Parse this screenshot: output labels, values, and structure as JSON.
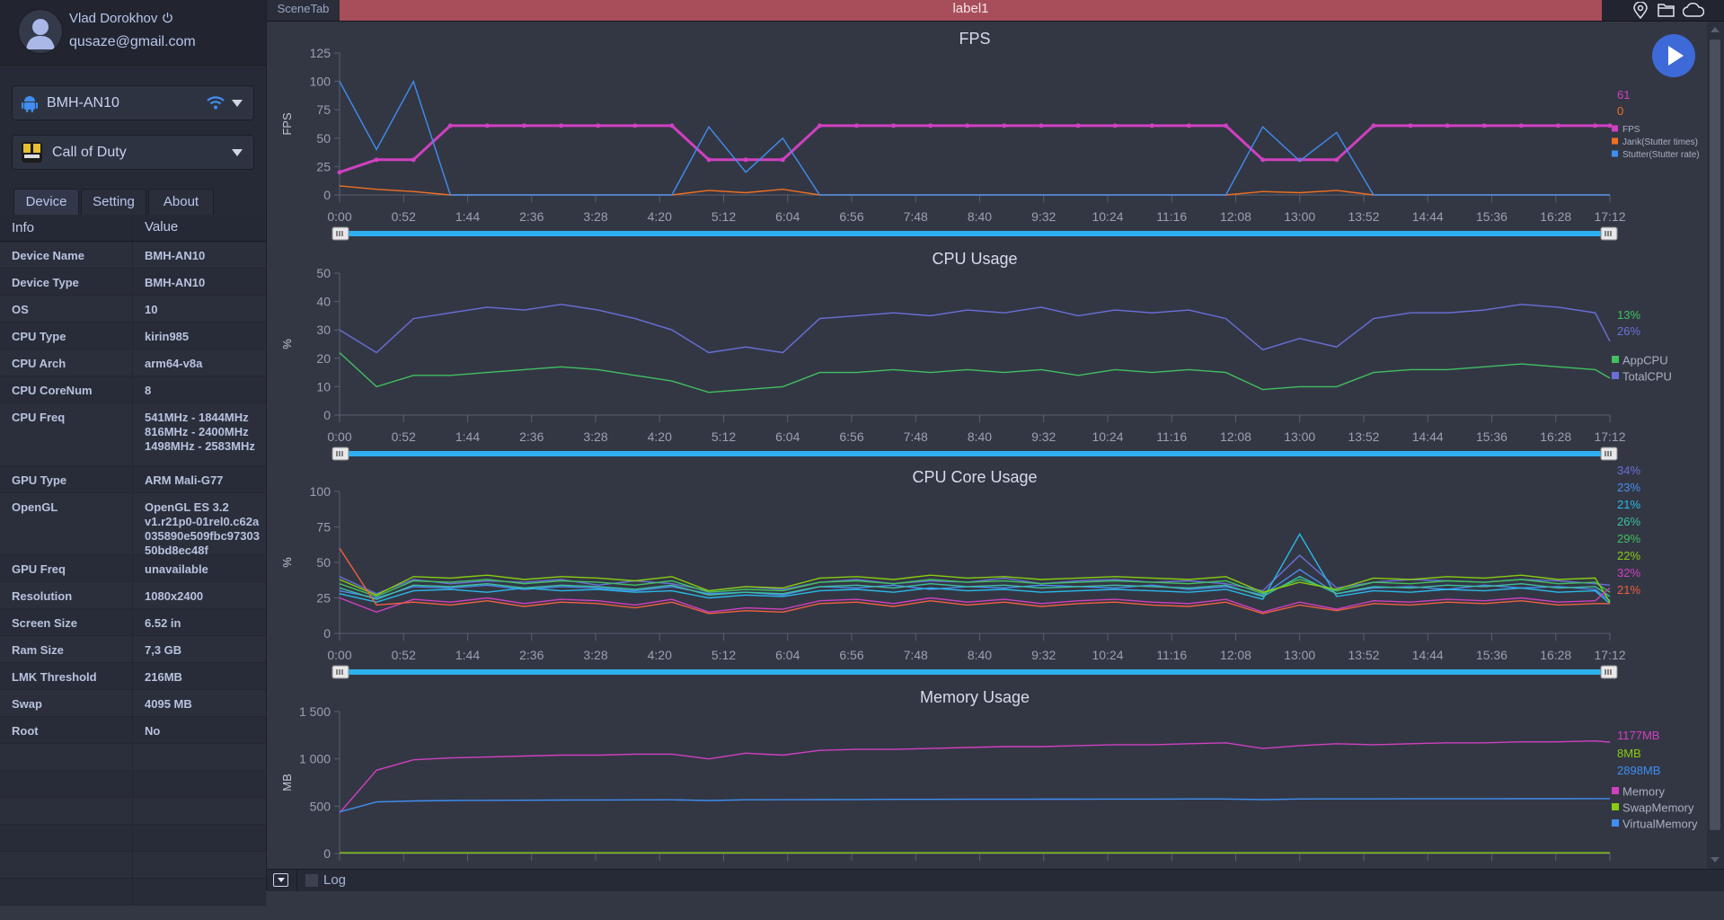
{
  "user": {
    "name": "Vlad Dorokhov",
    "email": "qusaze@gmail.com"
  },
  "device_select": {
    "value": "BMH-AN10"
  },
  "app_select": {
    "value": "Call of Duty"
  },
  "tabs": [
    "Device",
    "Setting",
    "About"
  ],
  "info_table": {
    "headers": [
      "Info",
      "Value"
    ],
    "rows": [
      [
        "Device Name",
        "BMH-AN10"
      ],
      [
        "Device Type",
        "BMH-AN10"
      ],
      [
        "OS",
        "10"
      ],
      [
        "CPU Type",
        "kirin985"
      ],
      [
        "CPU Arch",
        "arm64-v8a"
      ],
      [
        "CPU CoreNum",
        "8"
      ],
      [
        "CPU Freq",
        "541MHz - 1844MHz\n816MHz - 2400MHz\n1498MHz - 2583MHz"
      ],
      [
        "GPU Type",
        "ARM Mali-G77"
      ],
      [
        "OpenGL",
        "OpenGL ES 3.2\nv1.r21p0-01rel0.c62a035890e509fbc9730350bd8ec48f"
      ],
      [
        "GPU Freq",
        "unavailable"
      ],
      [
        "Resolution",
        "1080x2400"
      ],
      [
        "Screen Size",
        "6.52 in"
      ],
      [
        "Ram Size",
        "7,3 GB"
      ],
      [
        "LMK Threshold",
        "216MB"
      ],
      [
        "Swap",
        "4095 MB"
      ],
      [
        "Root",
        "No"
      ]
    ]
  },
  "topbar": {
    "scene_tab": "SceneTab",
    "label": "label1",
    "icons": [
      "location-pin-icon",
      "folder-icon",
      "cloud-icon"
    ]
  },
  "play_button": {
    "icon": "play-icon",
    "color": "#3d6ad8"
  },
  "bottombar": {
    "log_label": "Log",
    "log_checked": false
  },
  "colors": {
    "slider": "#2eb0f0",
    "label_bar": "#a84e5a"
  },
  "chart_data": [
    {
      "type": "line",
      "title": "FPS",
      "ylabel": "FPS",
      "ylim": [
        0,
        125
      ],
      "yticks": [
        "0",
        "25",
        "50",
        "75",
        "100",
        "125"
      ],
      "ytick_values": [
        0,
        25,
        50,
        75,
        100,
        125
      ],
      "xticks": [
        "0:00",
        "0:52",
        "1:44",
        "2:36",
        "3:28",
        "4:20",
        "5:12",
        "6:04",
        "6:56",
        "7:48",
        "8:40",
        "9:32",
        "10:24",
        "11:16",
        "12:08",
        "13:00",
        "13:52",
        "14:44",
        "15:36",
        "16:28",
        "17:12"
      ],
      "x": [
        "0:00",
        "0:30",
        "1:00",
        "1:30",
        "2:00",
        "2:30",
        "3:00",
        "3:30",
        "4:00",
        "4:30",
        "5:00",
        "5:30",
        "6:00",
        "6:30",
        "7:00",
        "7:30",
        "8:00",
        "8:30",
        "9:00",
        "9:30",
        "10:00",
        "10:30",
        "11:00",
        "11:30",
        "12:00",
        "12:30",
        "13:00",
        "13:30",
        "14:00",
        "14:30",
        "15:00",
        "15:30",
        "16:00",
        "16:30",
        "17:00",
        "17:12"
      ],
      "legend": "right",
      "current_values": [
        {
          "text": "61",
          "color": "#d040c0"
        },
        {
          "text": "0",
          "color": "#f07020"
        }
      ],
      "series": [
        {
          "name": "FPS",
          "color": "#d040c0",
          "markers": true,
          "values": [
            20,
            31,
            31,
            61,
            61,
            61,
            61,
            61,
            61,
            61,
            31,
            31,
            31,
            61,
            61,
            61,
            61,
            61,
            61,
            61,
            61,
            61,
            61,
            61,
            61,
            31,
            31,
            31,
            61,
            61,
            61,
            61,
            61,
            61,
            61,
            61
          ]
        },
        {
          "name": "Jank(Stutter times)",
          "color": "#f07020",
          "values": [
            8,
            5,
            3,
            0,
            0,
            0,
            0,
            0,
            0,
            0,
            4,
            2,
            5,
            0,
            0,
            0,
            0,
            0,
            0,
            0,
            0,
            0,
            0,
            0,
            0,
            3,
            2,
            4,
            0,
            0,
            0,
            0,
            0,
            0,
            0,
            0
          ]
        },
        {
          "name": "Stutter(Stutter rate)",
          "color": "#3f8ef0",
          "values": [
            100,
            40,
            100,
            0,
            0,
            0,
            0,
            0,
            0,
            0,
            60,
            20,
            50,
            0,
            0,
            0,
            0,
            0,
            0,
            0,
            0,
            0,
            0,
            0,
            0,
            60,
            30,
            55,
            0,
            0,
            0,
            0,
            0,
            0,
            0,
            0
          ]
        }
      ]
    },
    {
      "type": "line",
      "title": "CPU Usage",
      "ylabel": "%",
      "ylim": [
        0,
        50
      ],
      "yticks": [
        "0",
        "10",
        "20",
        "30",
        "40",
        "50"
      ],
      "ytick_values": [
        0,
        10,
        20,
        30,
        40,
        50
      ],
      "xticks": [
        "0:00",
        "0:52",
        "1:44",
        "2:36",
        "3:28",
        "4:20",
        "5:12",
        "6:04",
        "6:56",
        "7:48",
        "8:40",
        "9:32",
        "10:24",
        "11:16",
        "12:08",
        "13:00",
        "13:52",
        "14:44",
        "15:36",
        "16:28",
        "17:12"
      ],
      "x": [
        "0:00",
        "0:30",
        "1:00",
        "1:30",
        "2:00",
        "2:30",
        "3:00",
        "3:30",
        "4:00",
        "4:30",
        "5:00",
        "5:30",
        "6:00",
        "6:30",
        "7:00",
        "7:30",
        "8:00",
        "8:30",
        "9:00",
        "9:30",
        "10:00",
        "10:30",
        "11:00",
        "11:30",
        "12:00",
        "12:30",
        "13:00",
        "13:30",
        "14:00",
        "14:30",
        "15:00",
        "15:30",
        "16:00",
        "16:30",
        "17:00",
        "17:12"
      ],
      "legend": "right",
      "current_values": [
        {
          "text": "13%",
          "color": "#40c060"
        },
        {
          "text": "26%",
          "color": "#6a6fd8"
        }
      ],
      "series": [
        {
          "name": "AppCPU",
          "color": "#40c060",
          "values": [
            22,
            10,
            14,
            14,
            15,
            16,
            17,
            16,
            14,
            12,
            8,
            9,
            10,
            15,
            15,
            16,
            15,
            16,
            15,
            16,
            14,
            16,
            15,
            16,
            15,
            9,
            10,
            10,
            15,
            16,
            16,
            17,
            18,
            17,
            16,
            13
          ]
        },
        {
          "name": "TotalCPU",
          "color": "#6a6fd8",
          "values": [
            30,
            22,
            34,
            36,
            38,
            37,
            39,
            37,
            34,
            30,
            22,
            24,
            22,
            34,
            35,
            36,
            35,
            37,
            36,
            38,
            35,
            37,
            36,
            37,
            34,
            23,
            27,
            24,
            34,
            36,
            36,
            37,
            39,
            38,
            36,
            26
          ]
        }
      ]
    },
    {
      "type": "line",
      "title": "CPU Core Usage",
      "ylabel": "%",
      "ylim": [
        0,
        100
      ],
      "yticks": [
        "0",
        "25",
        "50",
        "75",
        "100"
      ],
      "ytick_values": [
        0,
        25,
        50,
        75,
        100
      ],
      "xticks": [
        "0:00",
        "0:52",
        "1:44",
        "2:36",
        "3:28",
        "4:20",
        "5:12",
        "6:04",
        "6:56",
        "7:48",
        "8:40",
        "9:32",
        "10:24",
        "11:16",
        "12:08",
        "13:00",
        "13:52",
        "14:44",
        "15:36",
        "16:28",
        "17:12"
      ],
      "x": [
        "0:00",
        "0:30",
        "1:00",
        "1:30",
        "2:00",
        "2:30",
        "3:00",
        "3:30",
        "4:00",
        "4:30",
        "5:00",
        "5:30",
        "6:00",
        "6:30",
        "7:00",
        "7:30",
        "8:00",
        "8:30",
        "9:00",
        "9:30",
        "10:00",
        "10:30",
        "11:00",
        "11:30",
        "12:00",
        "12:30",
        "13:00",
        "13:30",
        "14:00",
        "14:30",
        "15:00",
        "15:30",
        "16:00",
        "16:30",
        "17:00",
        "17:12"
      ],
      "legend": "none",
      "current_values": [
        {
          "text": "34%",
          "color": "#6a6fd8"
        },
        {
          "text": "23%",
          "color": "#4a8cf0"
        },
        {
          "text": "21%",
          "color": "#2ab8e8"
        },
        {
          "text": "26%",
          "color": "#3cc0a0"
        },
        {
          "text": "29%",
          "color": "#40c060"
        },
        {
          "text": "22%",
          "color": "#88cc10"
        },
        {
          "text": "32%",
          "color": "#d040c0"
        },
        {
          "text": "21%",
          "color": "#f06040"
        }
      ],
      "series": [
        {
          "color": "#6a6fd8",
          "values": [
            40,
            28,
            38,
            35,
            37,
            36,
            38,
            34,
            37,
            35,
            30,
            33,
            31,
            36,
            38,
            35,
            37,
            36,
            39,
            35,
            37,
            38,
            36,
            37,
            35,
            30,
            55,
            32,
            36,
            38,
            37,
            36,
            38,
            37,
            35,
            34
          ]
        },
        {
          "color": "#4a8cf0",
          "values": [
            30,
            25,
            33,
            32,
            34,
            31,
            33,
            32,
            30,
            33,
            28,
            29,
            27,
            33,
            32,
            34,
            31,
            33,
            32,
            34,
            33,
            32,
            34,
            31,
            33,
            27,
            45,
            28,
            32,
            33,
            31,
            34,
            32,
            33,
            31,
            23
          ]
        },
        {
          "color": "#2ab8e8",
          "values": [
            28,
            22,
            30,
            31,
            29,
            32,
            30,
            31,
            29,
            30,
            25,
            27,
            26,
            30,
            31,
            29,
            32,
            30,
            31,
            29,
            30,
            31,
            30,
            29,
            31,
            24,
            70,
            26,
            30,
            29,
            31,
            30,
            32,
            29,
            30,
            21
          ]
        },
        {
          "color": "#3cc0a0",
          "values": [
            32,
            24,
            34,
            33,
            35,
            32,
            34,
            33,
            31,
            34,
            27,
            29,
            28,
            33,
            34,
            32,
            35,
            33,
            34,
            32,
            33,
            34,
            33,
            32,
            34,
            26,
            40,
            28,
            33,
            32,
            34,
            33,
            35,
            32,
            33,
            26
          ]
        },
        {
          "color": "#40c060",
          "values": [
            35,
            26,
            37,
            36,
            38,
            35,
            37,
            36,
            34,
            37,
            29,
            31,
            30,
            36,
            37,
            35,
            38,
            36,
            37,
            35,
            36,
            37,
            36,
            35,
            37,
            28,
            38,
            30,
            36,
            35,
            37,
            36,
            38,
            35,
            36,
            29
          ]
        },
        {
          "color": "#88cc10",
          "values": [
            38,
            27,
            40,
            39,
            41,
            38,
            40,
            39,
            37,
            40,
            30,
            33,
            32,
            39,
            40,
            38,
            41,
            39,
            40,
            38,
            39,
            40,
            39,
            38,
            40,
            29,
            36,
            31,
            39,
            38,
            40,
            39,
            41,
            38,
            39,
            22
          ]
        },
        {
          "color": "#d040c0",
          "values": [
            25,
            15,
            24,
            22,
            25,
            21,
            24,
            23,
            20,
            24,
            15,
            18,
            17,
            23,
            24,
            21,
            25,
            22,
            24,
            21,
            23,
            24,
            22,
            21,
            24,
            15,
            22,
            17,
            23,
            22,
            24,
            23,
            25,
            22,
            23,
            32
          ]
        },
        {
          "color": "#f06040",
          "values": [
            60,
            20,
            22,
            20,
            23,
            19,
            22,
            21,
            18,
            22,
            14,
            16,
            15,
            21,
            22,
            19,
            23,
            20,
            22,
            19,
            21,
            22,
            20,
            19,
            22,
            14,
            20,
            16,
            21,
            20,
            22,
            21,
            23,
            20,
            21,
            21
          ]
        }
      ]
    },
    {
      "type": "line",
      "title": "Memory Usage",
      "ylabel": "MB",
      "ylim": [
        0,
        1500
      ],
      "yticks": [
        "0",
        "500",
        "1 000",
        "1 500"
      ],
      "ytick_values": [
        0,
        500,
        1000,
        1500
      ],
      "xticks": [],
      "x": [
        "0:00",
        "0:30",
        "1:00",
        "1:30",
        "2:00",
        "2:30",
        "3:00",
        "3:30",
        "4:00",
        "4:30",
        "5:00",
        "5:30",
        "6:00",
        "6:30",
        "7:00",
        "7:30",
        "8:00",
        "8:30",
        "9:00",
        "9:30",
        "10:00",
        "10:30",
        "11:00",
        "11:30",
        "12:00",
        "12:30",
        "13:00",
        "13:30",
        "14:00",
        "14:30",
        "15:00",
        "15:30",
        "16:00",
        "16:30",
        "17:00",
        "17:12"
      ],
      "legend": "right",
      "current_values": [
        {
          "text": "1177MB",
          "color": "#d040c0"
        },
        {
          "text": "8MB",
          "color": "#88cc10"
        },
        {
          "text": "2898MB",
          "color": "#3f8ef0"
        }
      ],
      "series": [
        {
          "name": "Memory",
          "color": "#d040c0",
          "values": [
            430,
            880,
            990,
            1010,
            1020,
            1030,
            1040,
            1040,
            1050,
            1050,
            1000,
            1060,
            1040,
            1090,
            1100,
            1100,
            1110,
            1120,
            1130,
            1130,
            1140,
            1150,
            1150,
            1160,
            1170,
            1110,
            1140,
            1160,
            1150,
            1160,
            1170,
            1170,
            1180,
            1180,
            1190,
            1177
          ]
        },
        {
          "name": "SwapMemory",
          "color": "#88cc10",
          "values": [
            8,
            8,
            8,
            8,
            8,
            8,
            8,
            8,
            8,
            8,
            8,
            8,
            8,
            8,
            8,
            8,
            8,
            8,
            8,
            8,
            8,
            8,
            8,
            8,
            8,
            8,
            8,
            8,
            8,
            8,
            8,
            8,
            8,
            8,
            8,
            8
          ]
        },
        {
          "name": "VirtualMemory",
          "color": "#3f8ef0",
          "values": [
            440,
            545,
            555,
            560,
            562,
            563,
            565,
            566,
            567,
            568,
            560,
            568,
            569,
            570,
            571,
            572,
            572,
            573,
            573,
            574,
            574,
            575,
            575,
            576,
            576,
            570,
            576,
            577,
            577,
            578,
            578,
            578,
            579,
            579,
            580,
            580
          ]
        }
      ]
    }
  ]
}
